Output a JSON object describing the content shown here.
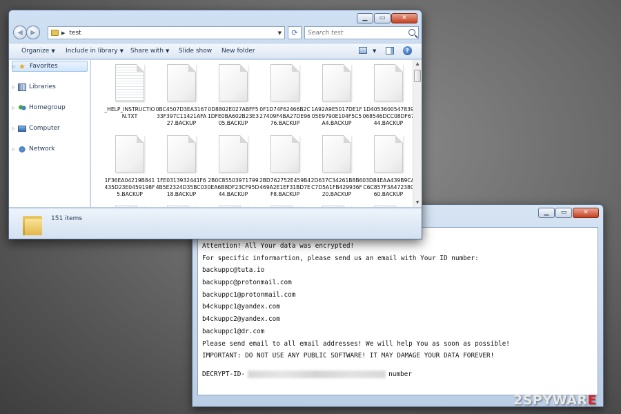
{
  "explorer": {
    "address_path": "test",
    "search_placeholder": "Search test",
    "toolbar": {
      "organize": "Organize",
      "include_in_library": "Include in library",
      "share_with": "Share with",
      "slide_show": "Slide show",
      "new_folder": "New folder"
    },
    "sidebar": [
      {
        "label": "Favorites",
        "icon": "star-icon"
      },
      {
        "label": "Libraries",
        "icon": "library-icon"
      },
      {
        "label": "Homegroup",
        "icon": "homegroup-icon"
      },
      {
        "label": "Computer",
        "icon": "computer-icon"
      },
      {
        "label": "Network",
        "icon": "network-icon"
      }
    ],
    "files": [
      "_HELP_INSTRUCTION.TXT",
      "0BC4507D3EA316733F397C11421AFA27.BACKUP",
      "0D8802E027ABFF51DFE0BA602B23E305.BACKUP",
      "0F1D74F62466B2C27409F4BA27DE9676.BACKUP",
      "1A92A9E5017DE1F05E9790E104F5C5A4.BACKUP",
      "1D4053600547839068546DCC08DF6744.BACKUP",
      "1F36EA04219B841435D23E0459198F5.BACKUP",
      "1FE0313932441F64B5E2324D35BC0318.BACKUP",
      "2B0C85503971799 0EA6B8DF23CF95D44.BACKUP",
      "2BD762752E459B4469A2E1EF31BD7EF8.BACKUP",
      "2D637C34261B8B6C7D5A1FB429936F20.BACKUP",
      "03D84EAA439B9CAC6C857F3A47238060.BACKUP"
    ],
    "status": "151 items"
  },
  "notepad": {
    "lines": [
      "Attention! All Your data was encrypted!",
      "For specific informartion, please send us an email with Your ID number:",
      "backuppc@tuta.io",
      "backuppc@protonmail.com",
      "backuppc1@protonmail.com",
      "b4ckuppc1@yandex.com",
      "b4ckuppc2@yandex.com",
      "backuppc1@dr.com",
      "Please send email to all email addresses! We will help You as soon as possible!",
      "IMPORTANT: DO NOT USE ANY PUBLIC SOFTWARE! IT MAY DAMAGE YOUR DATA FOREVER!"
    ],
    "decrypt_prefix": "DECRYPT-ID-",
    "decrypt_suffix": "number"
  },
  "watermark": {
    "prefix": "2SPYWAR",
    "highlight": "E"
  }
}
